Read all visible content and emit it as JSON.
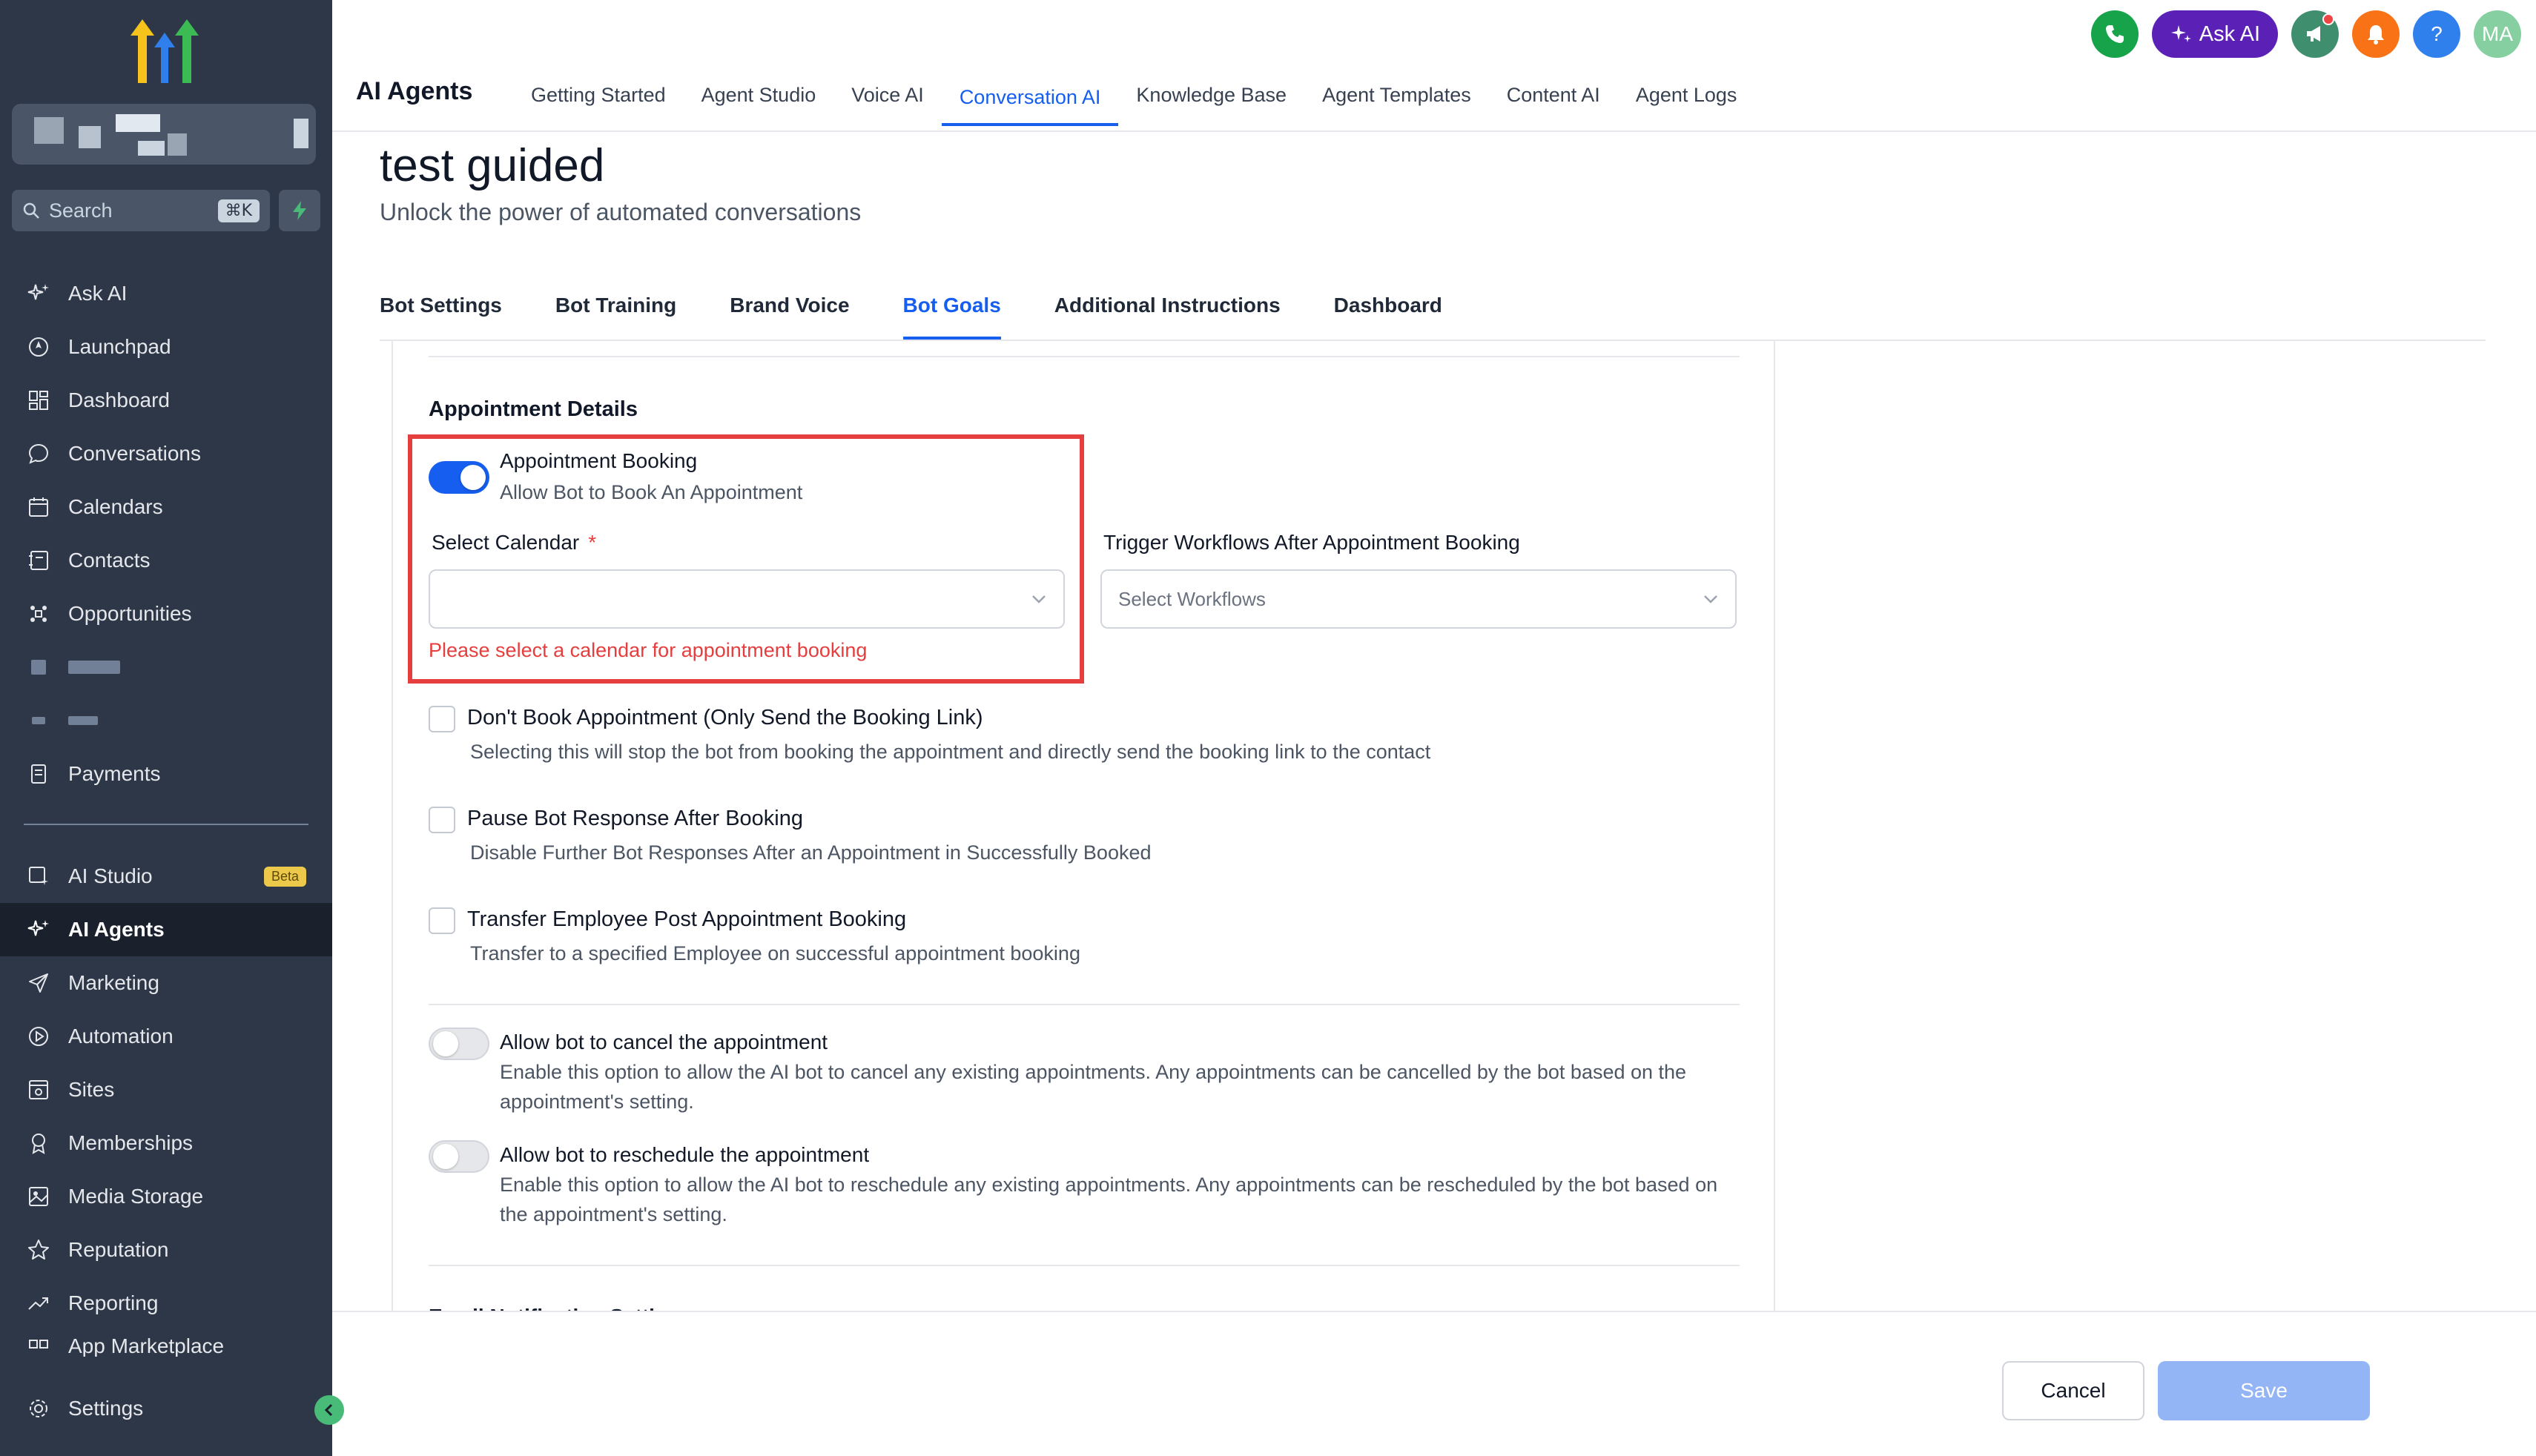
{
  "sidebar": {
    "search_placeholder": "Search",
    "search_shortcut": "⌘K",
    "items": [
      {
        "label": "Ask AI",
        "icon": "sparkle-icon"
      },
      {
        "label": "Launchpad",
        "icon": "rocket-icon"
      },
      {
        "label": "Dashboard",
        "icon": "grid-icon"
      },
      {
        "label": "Conversations",
        "icon": "chat-icon"
      },
      {
        "label": "Calendars",
        "icon": "calendar-icon"
      },
      {
        "label": "Contacts",
        "icon": "contacts-icon"
      },
      {
        "label": "Opportunities",
        "icon": "opportunities-icon"
      },
      {
        "label": "Payments",
        "icon": "payments-icon"
      }
    ],
    "items2": [
      {
        "label": "AI Studio",
        "icon": "ai-studio-icon",
        "badge": "Beta"
      },
      {
        "label": "AI Agents",
        "icon": "sparkle-icon",
        "active": true
      },
      {
        "label": "Marketing",
        "icon": "send-icon"
      },
      {
        "label": "Automation",
        "icon": "automation-icon"
      },
      {
        "label": "Sites",
        "icon": "sites-icon"
      },
      {
        "label": "Memberships",
        "icon": "award-icon"
      },
      {
        "label": "Media Storage",
        "icon": "image-icon"
      },
      {
        "label": "Reputation",
        "icon": "star-icon"
      },
      {
        "label": "Reporting",
        "icon": "trend-icon"
      },
      {
        "label": "App Marketplace",
        "icon": "apps-icon"
      }
    ],
    "settings_label": "Settings"
  },
  "header": {
    "app_title": "AI Agents",
    "tabs": [
      "Getting Started",
      "Agent Studio",
      "Voice AI",
      "Conversation AI",
      "Knowledge Base",
      "Agent Templates",
      "Content AI",
      "Agent Logs"
    ],
    "active_tab": "Conversation AI",
    "ask_ai_label": "Ask AI",
    "avatar_initials": "MA",
    "help_label": "?"
  },
  "page": {
    "title": "test guided",
    "subtitle": "Unlock the power of automated conversations",
    "tabs": [
      "Bot Settings",
      "Bot Training",
      "Brand Voice",
      "Bot Goals",
      "Additional Instructions",
      "Dashboard"
    ],
    "active_tab": "Bot Goals"
  },
  "appointment": {
    "section_title": "Appointment Details",
    "booking_toggle_label": "Appointment Booking",
    "booking_toggle_desc": "Allow Bot to Book An Appointment",
    "booking_enabled": true,
    "calendar_label": "Select Calendar",
    "calendar_required": "*",
    "calendar_value": "",
    "calendar_error": "Please select a calendar for appointment booking",
    "workflows_label": "Trigger Workflows After Appointment Booking",
    "workflows_placeholder": "Select Workflows",
    "options": [
      {
        "label": "Don't Book Appointment (Only Send the Booking Link)",
        "desc": "Selecting this will stop the bot from booking the appointment and directly send the booking link to the contact",
        "checked": false
      },
      {
        "label": "Pause Bot Response After Booking",
        "desc": "Disable Further Bot Responses After an Appointment in Successfully Booked",
        "checked": false
      },
      {
        "label": "Transfer Employee Post Appointment Booking",
        "desc": "Transfer to a specified Employee on successful appointment booking",
        "checked": false
      }
    ],
    "cancel_toggle_label": "Allow bot to cancel the appointment",
    "cancel_toggle_desc": "Enable this option to allow the AI bot to cancel any existing appointments. Any appointments can be cancelled by the bot based on the appointment's setting.",
    "reschedule_toggle_label": "Allow bot to reschedule the appointment",
    "reschedule_toggle_desc": "Enable this option to allow the AI bot to reschedule any existing appointments. Any appointments can be rescheduled by the bot based on the appointment's setting.",
    "next_section_cut": "Email Notification Settings"
  },
  "footer": {
    "cancel_label": "Cancel",
    "save_label": "Save"
  },
  "colors": {
    "sidebar_bg": "#2d3748",
    "accent": "#155eef",
    "error": "#e53e3e"
  }
}
